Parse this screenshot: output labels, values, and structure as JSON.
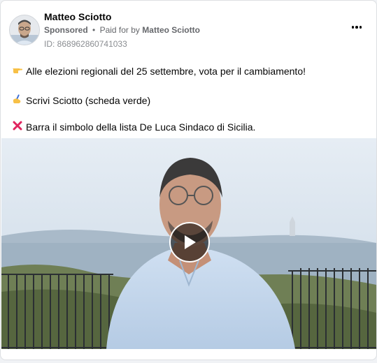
{
  "post": {
    "author_name": "Matteo Sciotto",
    "sponsored_label": "Sponsored",
    "separator": "•",
    "paid_for_prefix": "Paid for by",
    "paid_for_name": "Matteo Sciotto",
    "ad_id": "ID: 868962860741033",
    "lines": [
      {
        "icon": "pointing-hand-icon",
        "glyph": "👉",
        "text": "Alle elezioni regionali del 25 settembre, vota per il cambiamento!"
      },
      {
        "icon": "writing-hand-icon",
        "glyph": "✍️",
        "text": "Scrivi Sciotto (scheda verde)"
      },
      {
        "icon": "cross-mark-icon",
        "glyph": "❌",
        "text": "Barra il simbolo della lista De Luca Sindaco di Sicilia."
      }
    ]
  },
  "colors": {
    "text_primary": "#050505",
    "text_secondary": "#65676b",
    "cross_red": "#e0245e"
  },
  "video": {
    "play_icon": "play-icon",
    "more_icon": "more-options-icon"
  }
}
